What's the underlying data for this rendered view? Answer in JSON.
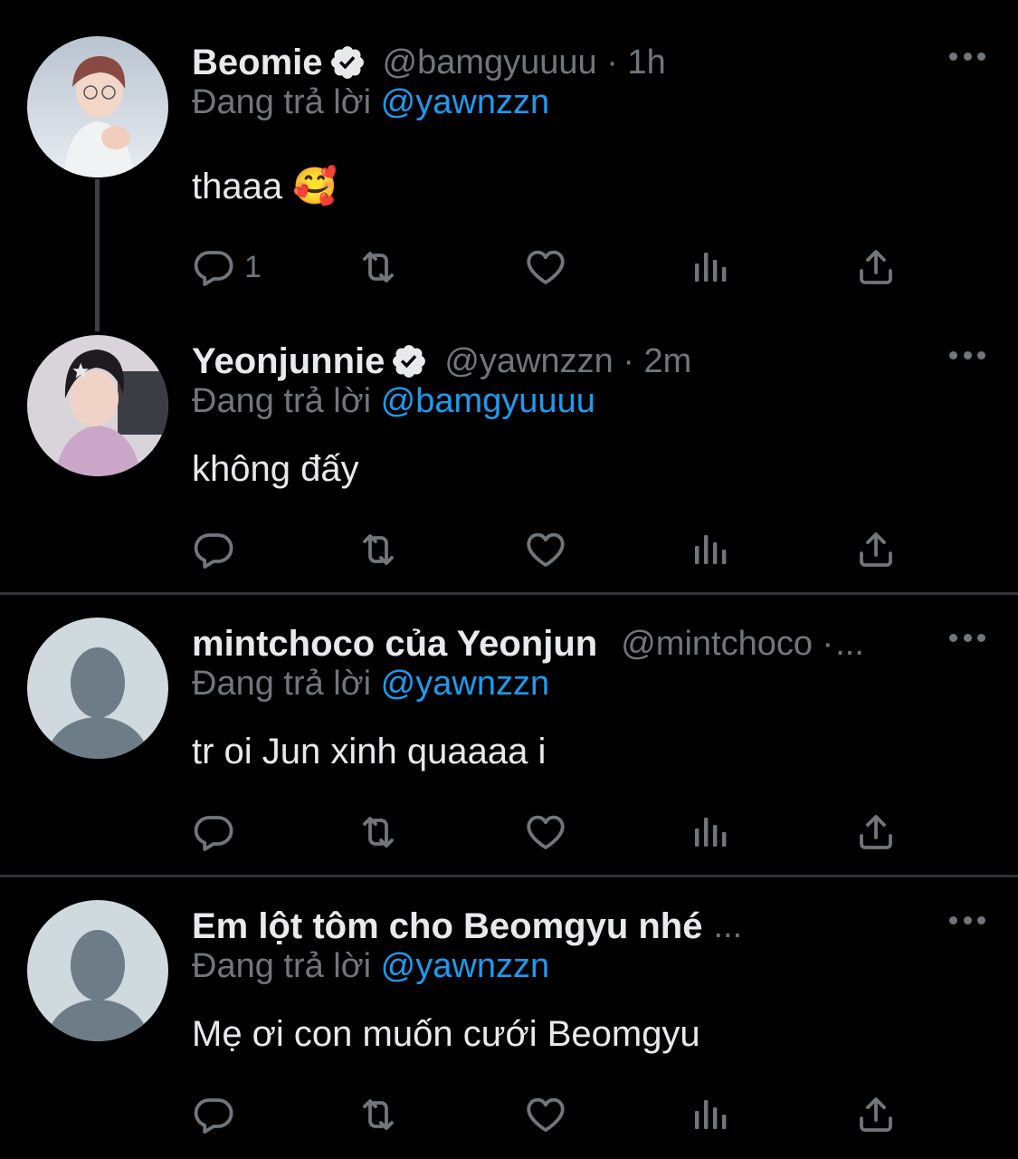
{
  "colors": {
    "background": "#000000",
    "text": "#e7e9ea",
    "muted": "#71767b",
    "link": "#1d9bf0",
    "divider": "#2f3336"
  },
  "icons": {
    "verified": "verified-badge-icon",
    "reply": "reply-icon",
    "retweet": "retweet-icon",
    "like": "heart-icon",
    "views": "views-icon",
    "share": "share-icon",
    "more": "more-icon"
  },
  "tweets": [
    {
      "name": "Beomie",
      "handle": "@bamgyuuuu · 1h",
      "reply_prefix": "Đang trả lời ",
      "reply_mention": "@yawnzzn",
      "text": "thaaa 🥰",
      "reply_count": "1"
    },
    {
      "name": "Yeonjunnie",
      "handle": "@yawnzzn · 2m",
      "reply_prefix": "Đang trả lời ",
      "reply_mention": "@bamgyuuuu",
      "text": "không đấy",
      "reply_count": ""
    },
    {
      "name": "mintchoco của Yeonjun",
      "handle": "@mintchoco ·",
      "ellipsis": "...",
      "reply_prefix": "Đang trả lời ",
      "reply_mention": "@yawnzzn",
      "text": "tr oi Jun xinh quaaaa i",
      "reply_count": ""
    },
    {
      "name": "Em lột tôm cho Beomgyu nhé",
      "handle": "",
      "ellipsis": "...",
      "reply_prefix": "Đang trả lời ",
      "reply_mention": "@yawnzzn",
      "text": "Mẹ ơi con muốn cưới Beomgyu",
      "reply_count": ""
    }
  ]
}
